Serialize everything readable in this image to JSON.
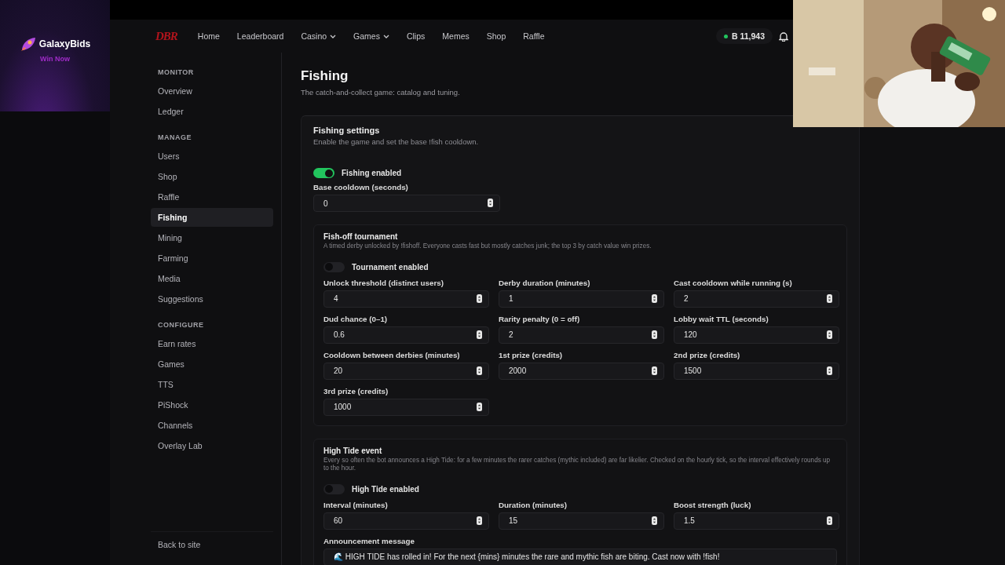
{
  "ad": {
    "title": "GalaxyBids",
    "subtitle": "Win Now"
  },
  "nav": {
    "logo": "DBR",
    "links": [
      {
        "label": "Home",
        "dropdown": false
      },
      {
        "label": "Leaderboard",
        "dropdown": false
      },
      {
        "label": "Casino",
        "dropdown": true
      },
      {
        "label": "Games",
        "dropdown": true
      },
      {
        "label": "Clips",
        "dropdown": false
      },
      {
        "label": "Memes",
        "dropdown": false
      },
      {
        "label": "Shop",
        "dropdown": false
      },
      {
        "label": "Raffle",
        "dropdown": false
      }
    ],
    "balance": "B 11,943"
  },
  "sidebar": {
    "sections": [
      {
        "heading": "MONITOR",
        "items": [
          {
            "label": "Overview",
            "selected": false
          },
          {
            "label": "Ledger",
            "selected": false
          }
        ]
      },
      {
        "heading": "MANAGE",
        "items": [
          {
            "label": "Users",
            "selected": false
          },
          {
            "label": "Shop",
            "selected": false
          },
          {
            "label": "Raffle",
            "selected": false
          },
          {
            "label": "Fishing",
            "selected": true
          },
          {
            "label": "Mining",
            "selected": false
          },
          {
            "label": "Farming",
            "selected": false
          },
          {
            "label": "Media",
            "selected": false
          },
          {
            "label": "Suggestions",
            "selected": false
          }
        ]
      },
      {
        "heading": "CONFIGURE",
        "items": [
          {
            "label": "Earn rates",
            "selected": false
          },
          {
            "label": "Games",
            "selected": false
          },
          {
            "label": "TTS",
            "selected": false
          },
          {
            "label": "PiShock",
            "selected": false
          },
          {
            "label": "Channels",
            "selected": false
          },
          {
            "label": "Overlay Lab",
            "selected": false
          }
        ]
      }
    ],
    "footer": "Back to site"
  },
  "page": {
    "title": "Fishing",
    "subtitle": "The catch-and-collect game: catalog and tuning."
  },
  "settings": {
    "title": "Fishing settings",
    "description": "Enable the game and set the base !fish cooldown.",
    "toggle": {
      "label": "Fishing enabled",
      "on": true
    },
    "fields": [
      {
        "label": "Base cooldown (seconds)",
        "value": "0"
      }
    ]
  },
  "tournament": {
    "title": "Fish-off tournament",
    "description": "A timed derby unlocked by !fishoff. Everyone casts fast but mostly catches junk; the top 3 by catch value win prizes.",
    "toggle": {
      "label": "Tournament enabled",
      "on": false
    },
    "fields": [
      {
        "label": "Unlock threshold (distinct users)",
        "value": "4"
      },
      {
        "label": "Derby duration (minutes)",
        "value": "1"
      },
      {
        "label": "Cast cooldown while running (s)",
        "value": "2"
      },
      {
        "label": "Dud chance (0–1)",
        "value": "0.6"
      },
      {
        "label": "Rarity penalty (0 = off)",
        "value": "2"
      },
      {
        "label": "Lobby wait TTL (seconds)",
        "value": "120"
      },
      {
        "label": "Cooldown between derbies (minutes)",
        "value": "20"
      },
      {
        "label": "1st prize (credits)",
        "value": "2000"
      },
      {
        "label": "2nd prize (credits)",
        "value": "1500"
      },
      {
        "label": "3rd prize (credits)",
        "value": "1000"
      }
    ]
  },
  "high_tide": {
    "title": "High Tide event",
    "description": "Every so often the bot announces a High Tide: for a few minutes the rarer catches (mythic included) are far likelier. Checked on the hourly tick, so the interval effectively rounds up to the hour.",
    "toggle": {
      "label": "High Tide enabled",
      "on": false
    },
    "fields": [
      {
        "label": "Interval (minutes)",
        "value": "60"
      },
      {
        "label": "Duration (minutes)",
        "value": "15"
      },
      {
        "label": "Boost strength (luck)",
        "value": "1.5"
      }
    ],
    "message": {
      "label": "Announcement message",
      "value": "🌊 HIGH TIDE has rolled in! For the next {mins} minutes the rare and mythic fish are biting. Cast now with !fish!"
    }
  }
}
